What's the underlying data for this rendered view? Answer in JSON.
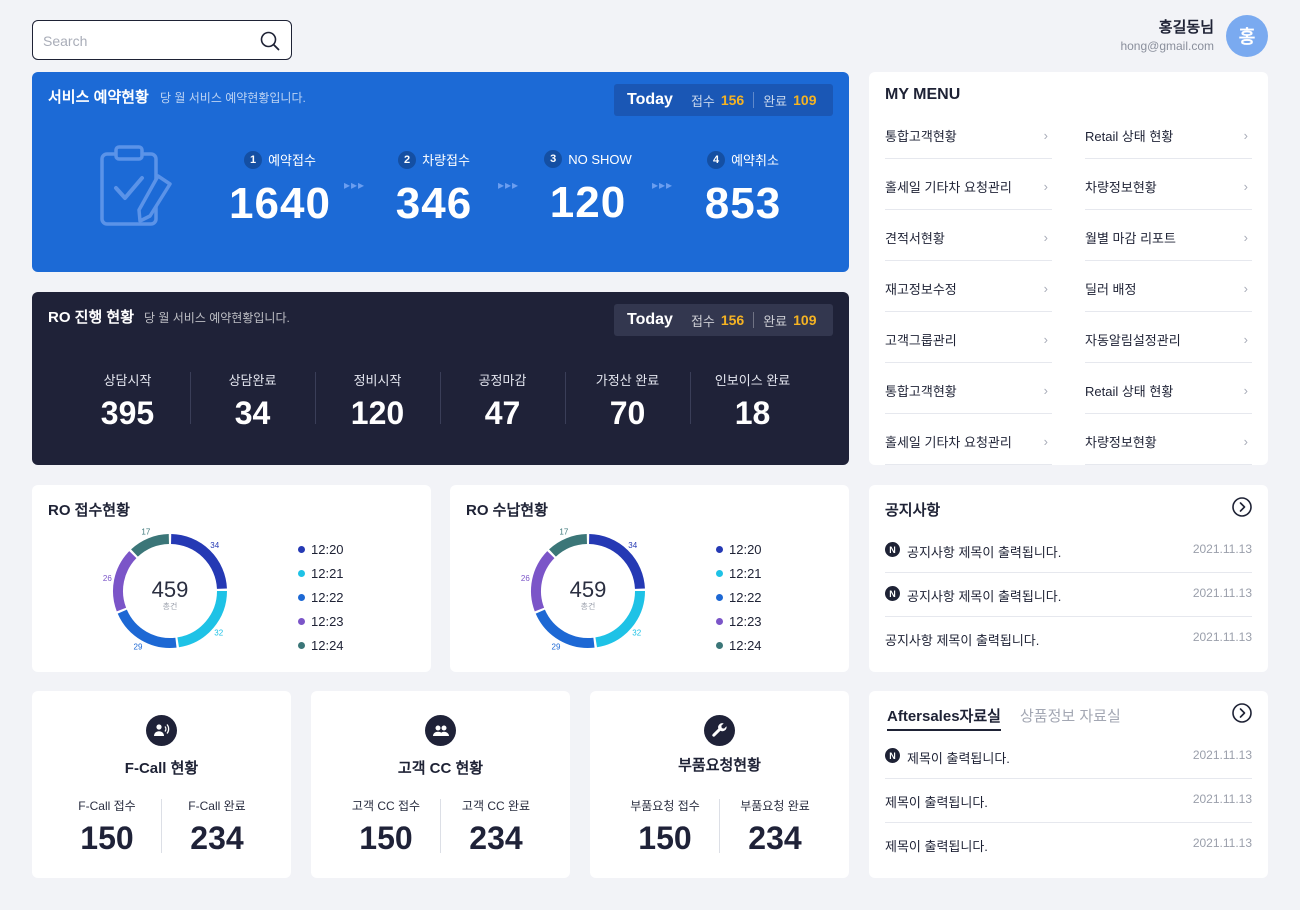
{
  "search": {
    "placeholder": "Search"
  },
  "user": {
    "name": "홍길동님",
    "email": "hong@gmail.com",
    "avatar": "홍"
  },
  "service": {
    "title": "서비스 예약현황",
    "subtitle": "당 월 서비스 예약현황입니다.",
    "today": {
      "label": "Today",
      "received_label": "접수",
      "received": "156",
      "done_label": "완료",
      "done": "109"
    },
    "steps": [
      {
        "num": "1",
        "label": "예약접수",
        "value": "1640"
      },
      {
        "num": "2",
        "label": "차량접수",
        "value": "346"
      },
      {
        "num": "3",
        "label": "NO SHOW",
        "value": "120"
      },
      {
        "num": "4",
        "label": "예약취소",
        "value": "853"
      }
    ],
    "arrow": "▸▸▸"
  },
  "ro_progress": {
    "title": "RO 진행 현황",
    "subtitle": "당 월 서비스 예약현황입니다.",
    "today": {
      "label": "Today",
      "received_label": "접수",
      "received": "156",
      "done_label": "완료",
      "done": "109"
    },
    "stats": [
      {
        "label": "상담시작",
        "value": "395"
      },
      {
        "label": "상담완료",
        "value": "34"
      },
      {
        "label": "정비시작",
        "value": "120"
      },
      {
        "label": "공정마감",
        "value": "47"
      },
      {
        "label": "가정산 완료",
        "value": "70"
      },
      {
        "label": "인보이스 완료",
        "value": "18"
      }
    ]
  },
  "my_menu": {
    "title": "MY MENU",
    "chevron": "›",
    "left": [
      "통합고객현황",
      "홀세일 기타차 요청관리",
      "견적서현황",
      "재고정보수정",
      "고객그룹관리",
      "통합고객현황",
      "홀세일 기타차 요청관리"
    ],
    "right": [
      "Retail 상태 현황",
      "차량정보현황",
      "월별 마감 리포트",
      "딜러 배정",
      "자동알림설정관리",
      "Retail 상태 현황",
      "차량정보현황"
    ]
  },
  "colors": {
    "c1": "#2539b4",
    "c2": "#1ec2e6",
    "c3": "#1d68d4",
    "c4": "#7b55c8",
    "c5": "#3b7678"
  },
  "ro_receipt": {
    "title": "RO 접수현황",
    "total": "459",
    "total_label": "총건",
    "chart_data": {
      "type": "pie",
      "categories": [
        "12:20",
        "12:21",
        "12:22",
        "12:23",
        "12:24"
      ],
      "values": [
        34,
        32,
        29,
        26,
        17
      ],
      "labels": [
        "34",
        "32",
        "29",
        "26",
        "17"
      ]
    }
  },
  "ro_payment": {
    "title": "RO 수납현황",
    "total": "459",
    "total_label": "총건",
    "chart_data": {
      "type": "pie",
      "categories": [
        "12:20",
        "12:21",
        "12:22",
        "12:23",
        "12:24"
      ],
      "values": [
        34,
        32,
        29,
        26,
        17
      ],
      "labels": [
        "34",
        "32",
        "29",
        "26",
        "17"
      ]
    }
  },
  "notice": {
    "title": "공지사항",
    "items": [
      {
        "badge": "N",
        "text": "공지사항 제목이 출력됩니다.",
        "date": "2021.11.13"
      },
      {
        "badge": "N",
        "text": "공지사항 제목이 출력됩니다.",
        "date": "2021.11.13"
      },
      {
        "badge": "",
        "text": "공지사항 제목이 출력됩니다.",
        "date": "2021.11.13"
      }
    ]
  },
  "stat_cards": [
    {
      "title": "F-Call 현황",
      "left_label": "F-Call 접수",
      "left_value": "150",
      "right_label": "F-Call 완료",
      "right_value": "234"
    },
    {
      "title": "고객 CC 현황",
      "left_label": "고객 CC 접수",
      "left_value": "150",
      "right_label": "고객 CC 완료",
      "right_value": "234"
    },
    {
      "title": "부품요청현황",
      "left_label": "부품요청 접수",
      "left_value": "150",
      "right_label": "부품요청 완료",
      "right_value": "234"
    }
  ],
  "aftersales": {
    "tab_active": "Aftersales자료실",
    "tab_other": "상품정보 자료실",
    "items": [
      {
        "badge": "N",
        "text": "제목이 출력됩니다.",
        "date": "2021.11.13"
      },
      {
        "badge": "",
        "text": "제목이 출력됩니다.",
        "date": "2021.11.13"
      },
      {
        "badge": "",
        "text": "제목이 출력됩니다.",
        "date": "2021.11.13"
      }
    ]
  }
}
